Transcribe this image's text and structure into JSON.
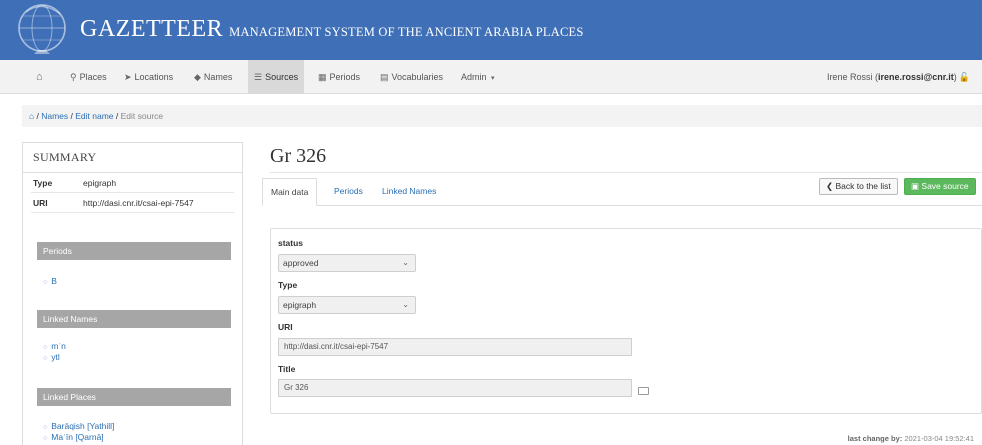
{
  "header": {
    "title_big": "GAZETTEER",
    "title_sub": "MANAGEMENT SYSTEM OF THE ANCIENT ARABIA PLACES",
    "bg_color": "#3f6fb7"
  },
  "navbar": {
    "items": [
      {
        "icon": "home-icon",
        "label": ""
      },
      {
        "icon": "map-marker-icon",
        "label": "Places"
      },
      {
        "icon": "location-arrow-icon",
        "label": "Locations"
      },
      {
        "icon": "tag-icon",
        "label": "Names"
      },
      {
        "icon": "list-icon",
        "label": "Sources",
        "active": true
      },
      {
        "icon": "calendar-icon",
        "label": "Periods"
      },
      {
        "icon": "book-icon",
        "label": "Vocabularies"
      },
      {
        "icon": "",
        "label": "Admin"
      }
    ],
    "user_name": "Irene Rossi",
    "user_email": "irene.rossi@cnr.it"
  },
  "breadcrumb": {
    "names": "Names",
    "edit_name": "Edit name",
    "current": "Edit source"
  },
  "summary": {
    "title": "SUMMARY",
    "type_key": "Type",
    "type_val": "epigraph",
    "uri_key": "URI",
    "uri_val": "http://dasi.cnr.it/csai-epi-7547",
    "periods_title": "Periods",
    "periods": [
      "B"
    ],
    "linked_names_title": "Linked Names",
    "linked_names": [
      "mʿn",
      "ytl"
    ],
    "linked_places_title": "Linked Places",
    "linked_places": [
      "Barāqish [Yathill]",
      "Maʿīn [Qarnā]"
    ]
  },
  "main": {
    "title": "Gr 326",
    "tabs": [
      "Main data",
      "Periods",
      "Linked Names"
    ],
    "back_label": "Back to the list",
    "save_label": "Save source",
    "status_label": "status",
    "status_value": "approved",
    "type_label": "Type",
    "type_value": "epigraph",
    "uri_label": "URI",
    "uri_value": "http://dasi.cnr.it/csai-epi-7547",
    "title_label": "Title",
    "title_value": "Gr 326"
  },
  "footer": {
    "last_change_label": "last change by:",
    "last_change_value": "2021-03-04 19:52:41"
  }
}
